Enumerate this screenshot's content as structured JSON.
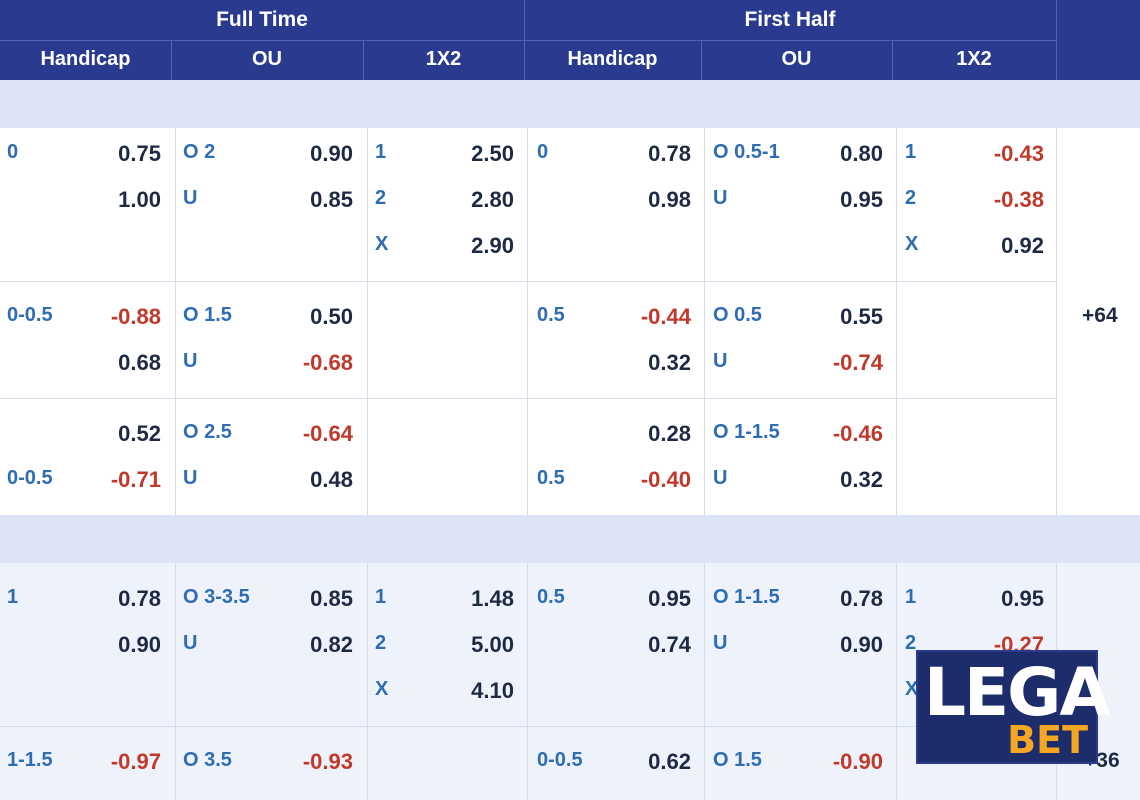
{
  "header": {
    "full_time": "Full Time",
    "first_half": "First Half",
    "handicap": "Handicap",
    "ou": "OU",
    "x12": "1X2"
  },
  "rows": [
    {
      "ft_hdp": {
        "l1": "0",
        "o1": "0.75",
        "l2": "",
        "o2": "1.00"
      },
      "ft_ou": {
        "l1": "O  2",
        "o1": "0.90",
        "l2": "U",
        "o2": "0.85"
      },
      "ft_1x2": {
        "a": "1",
        "av": "2.50",
        "b": "2",
        "bv": "2.80",
        "c": "X",
        "cv": "2.90"
      },
      "fh_hdp": {
        "l1": "0",
        "o1": "0.78",
        "l2": "",
        "o2": "0.98"
      },
      "fh_ou": {
        "l1": "O  0.5-1",
        "o1": "0.80",
        "l2": "U",
        "o2": "0.95"
      },
      "fh_1x2": {
        "a": "1",
        "av": "-0.43",
        "b": "2",
        "bv": "-0.38",
        "c": "X",
        "cv": "0.92"
      }
    },
    {
      "ft_hdp": {
        "l1": "0-0.5",
        "o1": "-0.88",
        "l2": "",
        "o2": "0.68"
      },
      "ft_ou": {
        "l1": "O  1.5",
        "o1": "0.50",
        "l2": "U",
        "o2": "-0.68"
      },
      "fh_hdp": {
        "l1": "0.5",
        "o1": "-0.44",
        "l2": "",
        "o2": "0.32"
      },
      "fh_ou": {
        "l1": "O  0.5",
        "o1": "0.55",
        "l2": "U",
        "o2": "-0.74"
      }
    },
    {
      "ft_hdp": {
        "l1": "",
        "o1": "0.52",
        "l2": "0-0.5",
        "o2": "-0.71"
      },
      "ft_ou": {
        "l1": "O  2.5",
        "o1": "-0.64",
        "l2": "U",
        "o2": "0.48"
      },
      "fh_hdp": {
        "l1": "",
        "o1": "0.28",
        "l2": "0.5",
        "o2": "-0.40"
      },
      "fh_ou": {
        "l1": "O  1-1.5",
        "o1": "-0.46",
        "l2": "U",
        "o2": "0.32"
      }
    },
    {
      "ft_hdp": {
        "l1": "1",
        "o1": "0.78",
        "l2": "",
        "o2": "0.90"
      },
      "ft_ou": {
        "l1": "O  3-3.5",
        "o1": "0.85",
        "l2": "U",
        "o2": "0.82"
      },
      "ft_1x2": {
        "a": "1",
        "av": "1.48",
        "b": "2",
        "bv": "5.00",
        "c": "X",
        "cv": "4.10"
      },
      "fh_hdp": {
        "l1": "0.5",
        "o1": "0.95",
        "l2": "",
        "o2": "0.74"
      },
      "fh_ou": {
        "l1": "O  1-1.5",
        "o1": "0.78",
        "l2": "U",
        "o2": "0.90"
      },
      "fh_1x2": {
        "a": "1",
        "av": "0.95",
        "b": "2",
        "bv": "-0.27",
        "c": "X",
        "cv": ""
      }
    },
    {
      "ft_hdp": {
        "l1": "1-1.5",
        "o1": "-0.97"
      },
      "ft_ou": {
        "l1": "O  3.5",
        "o1": "-0.93"
      },
      "fh_hdp": {
        "l1": "0-0.5",
        "o1": "0.62"
      },
      "fh_ou": {
        "l1": "O  1.5",
        "o1": "-0.90"
      }
    }
  ],
  "more_1": "+64",
  "more_2": "+36",
  "logo": {
    "line1": "LEGA",
    "line2": "BET"
  },
  "colors": {
    "header_bg": "#2a3a8e",
    "line_label": "#2f6db3",
    "negative": "#c0392b",
    "positive": "#1e2a44",
    "logo_accent": "#f5a623"
  }
}
